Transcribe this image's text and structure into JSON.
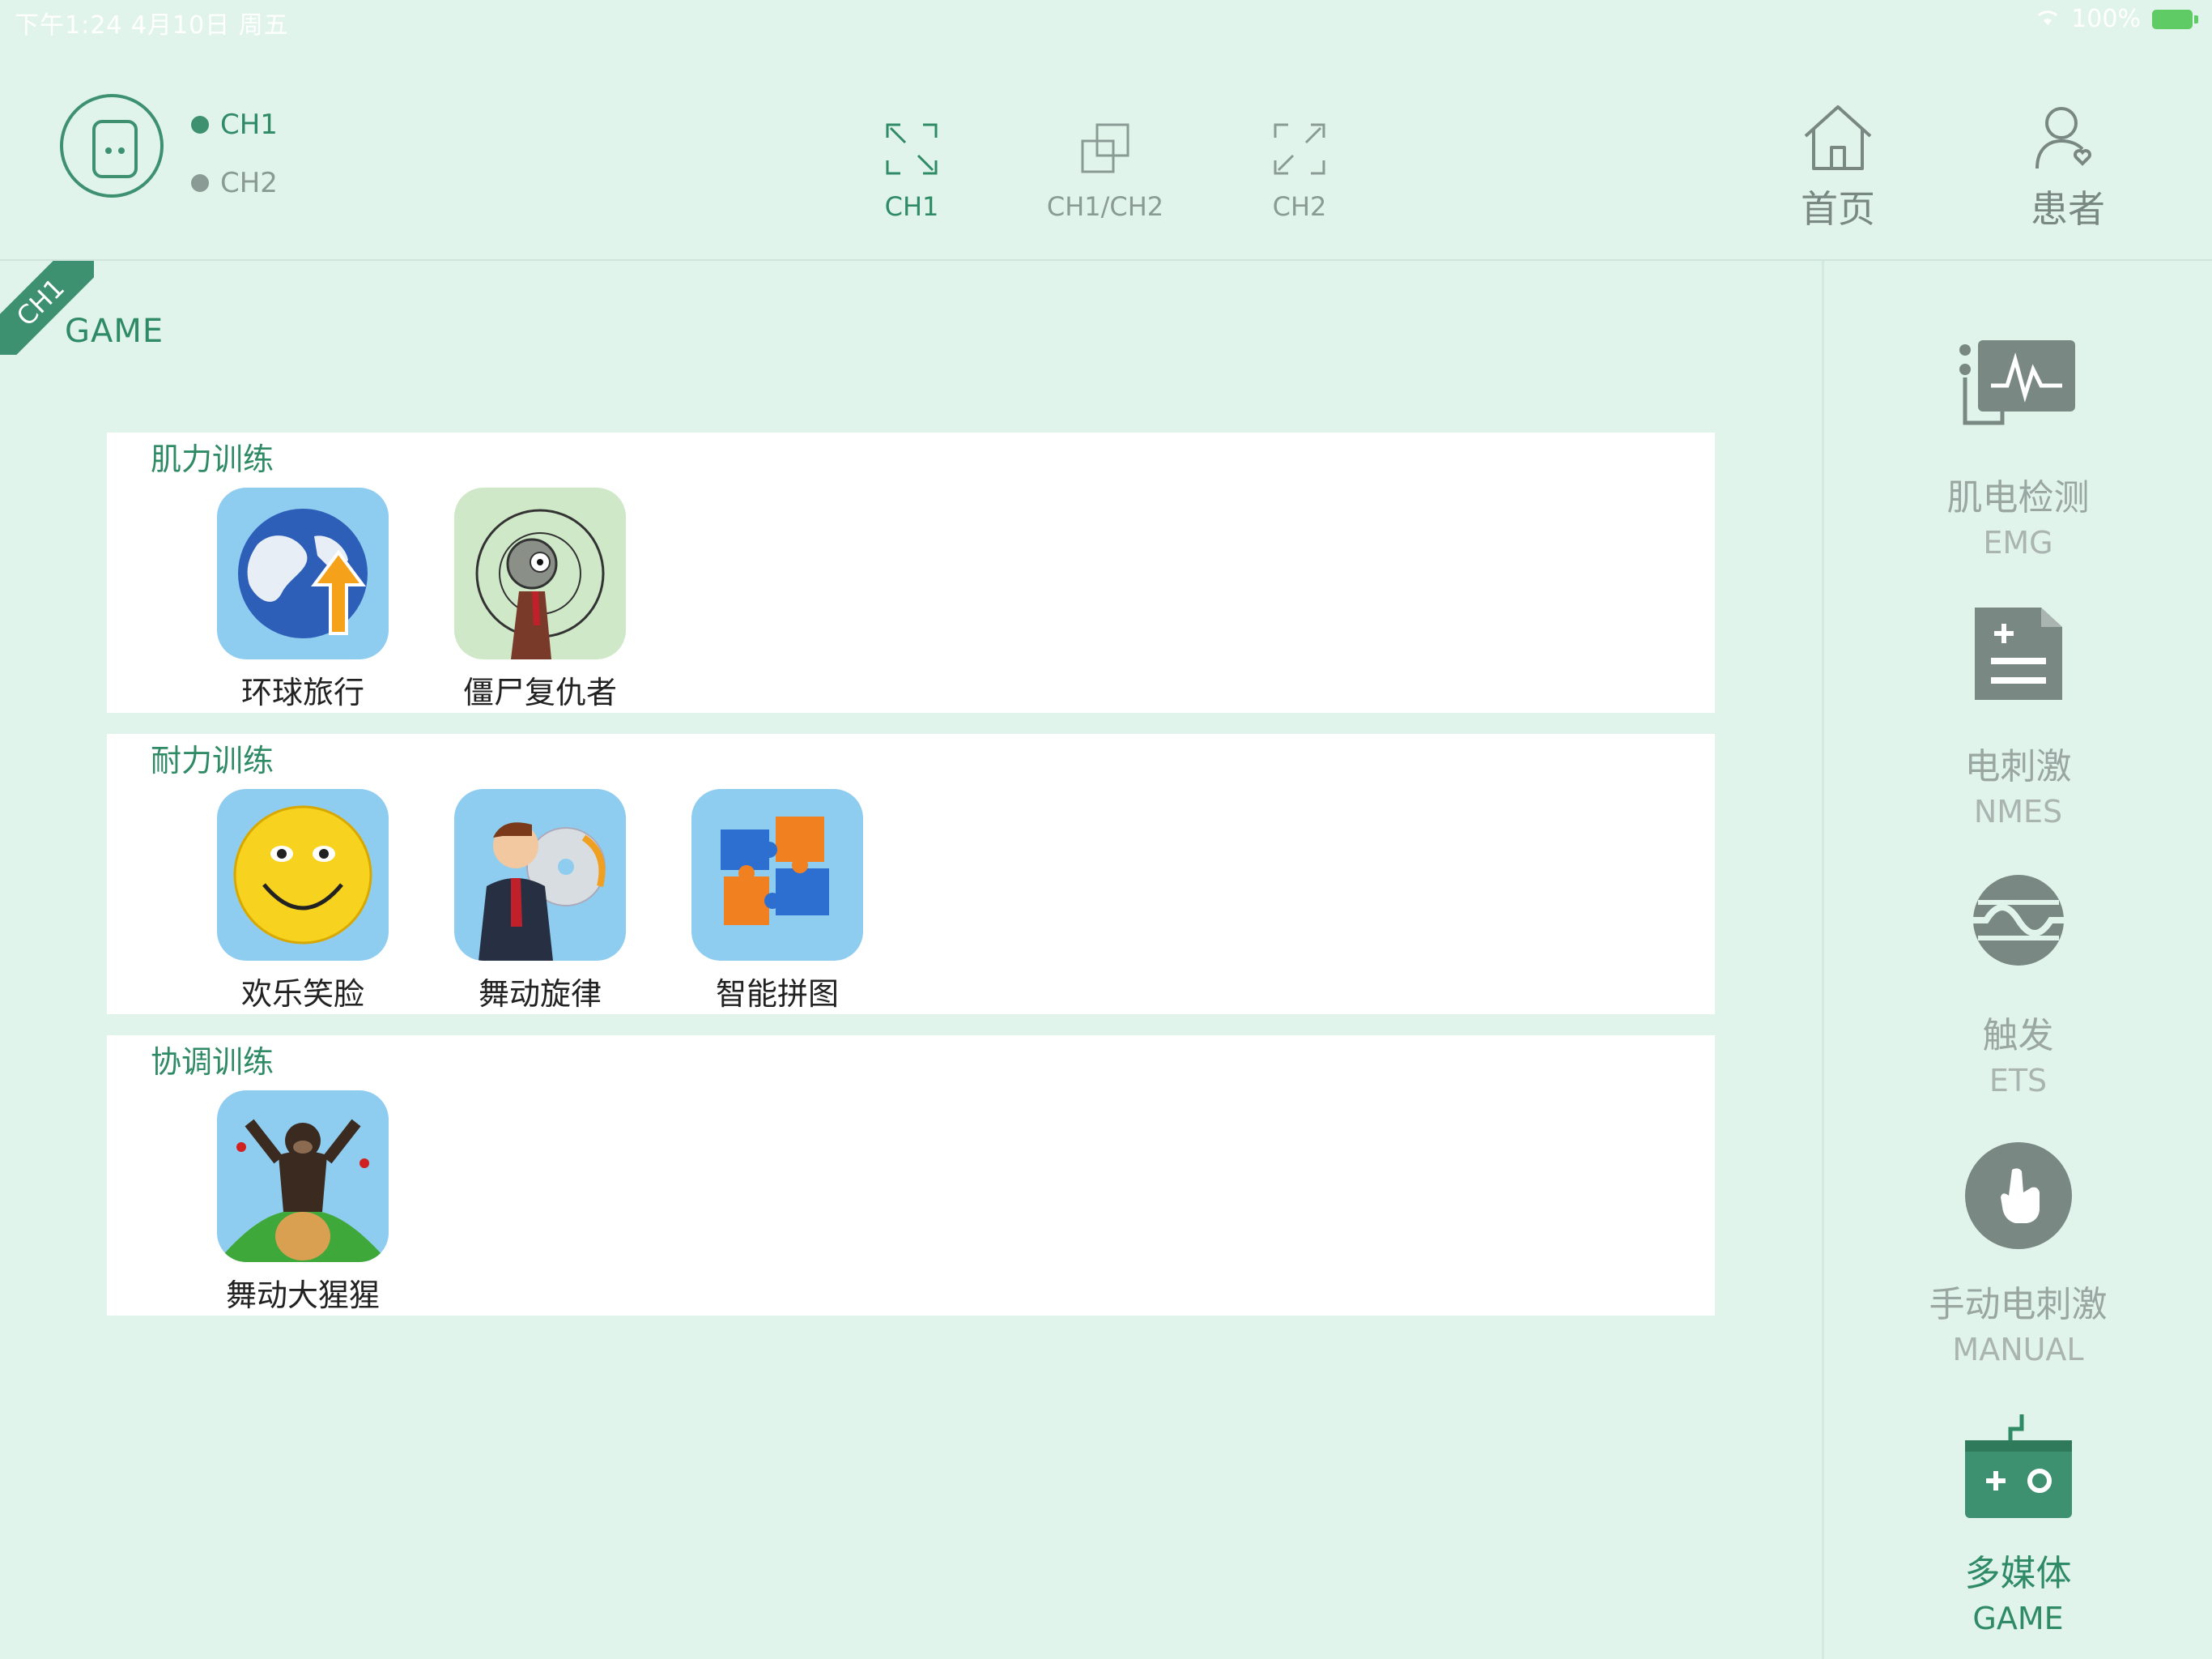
{
  "status_bar": {
    "time_date": "下午1:24   4月10日 周五",
    "battery": "100%"
  },
  "device": {
    "channels": [
      {
        "label": "CH1",
        "color": "#3d9070",
        "text_color": "#2f8a66"
      },
      {
        "label": "CH2",
        "color": "#8a9a94",
        "text_color": "#8a9a94"
      }
    ]
  },
  "tabs": [
    {
      "label": "CH1",
      "active": true,
      "icon": "expand-icon"
    },
    {
      "label": "CH1/CH2",
      "active": false,
      "icon": "dual-window-icon"
    },
    {
      "label": "CH2",
      "active": false,
      "icon": "expand-icon"
    }
  ],
  "nav": {
    "home": "首页",
    "patient": "患者"
  },
  "content": {
    "channel_badge": "CH1",
    "section_title": "GAME",
    "panels": [
      {
        "title": "肌力训练",
        "games": [
          "环球旅行",
          "僵尸复仇者"
        ]
      },
      {
        "title": "耐力训练",
        "games": [
          "欢乐笑脸",
          "舞动旋律",
          "智能拼图"
        ]
      },
      {
        "title": "协调训练",
        "games": [
          "舞动大猩猩"
        ]
      }
    ]
  },
  "sidebar": {
    "items": [
      {
        "cn": "肌电检测",
        "en": "EMG",
        "icon": "emg-monitor-icon"
      },
      {
        "cn": "电刺激",
        "en": "NMES",
        "icon": "document-icon"
      },
      {
        "cn": "触发",
        "en": "ETS",
        "icon": "trigger-wave-icon"
      },
      {
        "cn": "手动电刺激",
        "en": "MANUAL",
        "icon": "hand-tap-icon"
      },
      {
        "cn": "多媒体",
        "en": "GAME",
        "icon": "gamepad-icon",
        "active": true
      }
    ]
  },
  "colors": {
    "accent": "#3d9070",
    "background": "#e0f4ec",
    "inactive": "#8a9a94"
  }
}
